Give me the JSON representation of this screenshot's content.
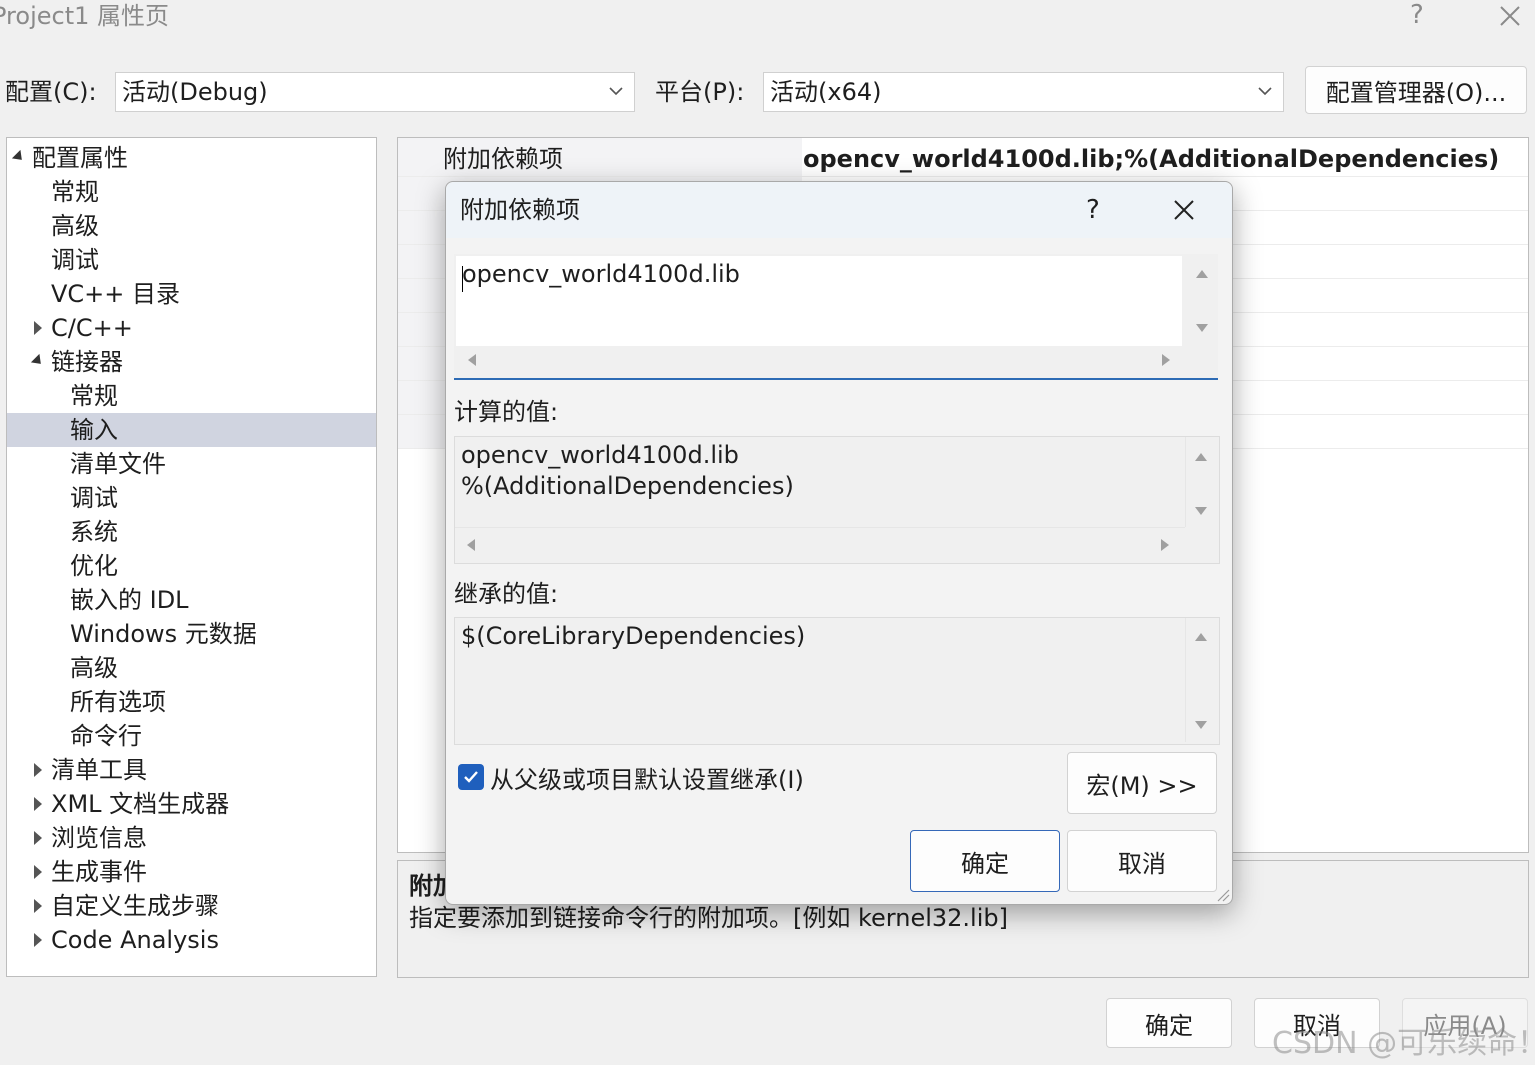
{
  "window": {
    "title": "Project1 属性页",
    "help": "?"
  },
  "toolbar": {
    "config_label": "配置(C):",
    "config_value": "活动(Debug)",
    "platform_label": "平台(P):",
    "platform_value": "活动(x64)",
    "config_manager": "配置管理器(O)..."
  },
  "tree": {
    "items": [
      {
        "label": "配置属性",
        "expander": "expanded"
      },
      {
        "label": "常规"
      },
      {
        "label": "高级"
      },
      {
        "label": "调试"
      },
      {
        "label": "VC++ 目录"
      },
      {
        "label": "C/C++",
        "expander": "collapsed"
      },
      {
        "label": "链接器",
        "expander": "expanded"
      },
      {
        "label": "常规"
      },
      {
        "label": "输入",
        "selected": true
      },
      {
        "label": "清单文件"
      },
      {
        "label": "调试"
      },
      {
        "label": "系统"
      },
      {
        "label": "优化"
      },
      {
        "label": "嵌入的 IDL"
      },
      {
        "label": "Windows 元数据"
      },
      {
        "label": "高级"
      },
      {
        "label": "所有选项"
      },
      {
        "label": "命令行"
      },
      {
        "label": "清单工具",
        "expander": "collapsed"
      },
      {
        "label": "XML 文档生成器",
        "expander": "collapsed"
      },
      {
        "label": "浏览信息",
        "expander": "collapsed"
      },
      {
        "label": "生成事件",
        "expander": "collapsed"
      },
      {
        "label": "自定义生成步骤",
        "expander": "collapsed"
      },
      {
        "label": "Code Analysis",
        "expander": "collapsed"
      }
    ]
  },
  "grid": {
    "first_row_name": "附加依赖项",
    "first_row_value": "opencv_world4100d.lib;%(AdditionalDependencies)"
  },
  "description": {
    "title": "附加",
    "text": "指定要添加到链接命令行的附加项。[例如 kernel32.lib]"
  },
  "dialog": {
    "title": "附加依赖项",
    "help": "?",
    "edit_value": "opencv_world4100d.lib",
    "computed_label": "计算的值:",
    "computed_lines": [
      "opencv_world4100d.lib",
      "%(AdditionalDependencies)"
    ],
    "inherited_label": "继承的值:",
    "inherited_value": "$(CoreLibraryDependencies)",
    "inherit_checkbox_label": "从父级或项目默认设置继承(I)",
    "inherit_checked": true,
    "macro_button": "宏(M) >>",
    "ok": "确定",
    "cancel": "取消"
  },
  "footer": {
    "ok": "确定",
    "cancel": "取消",
    "apply": "应用(A)"
  },
  "watermark": "CSDN @可乐续命！",
  "colors": {
    "accent": "#1f5fbd",
    "selection": "#d0d4e0",
    "divider": "#2d6bb5"
  }
}
